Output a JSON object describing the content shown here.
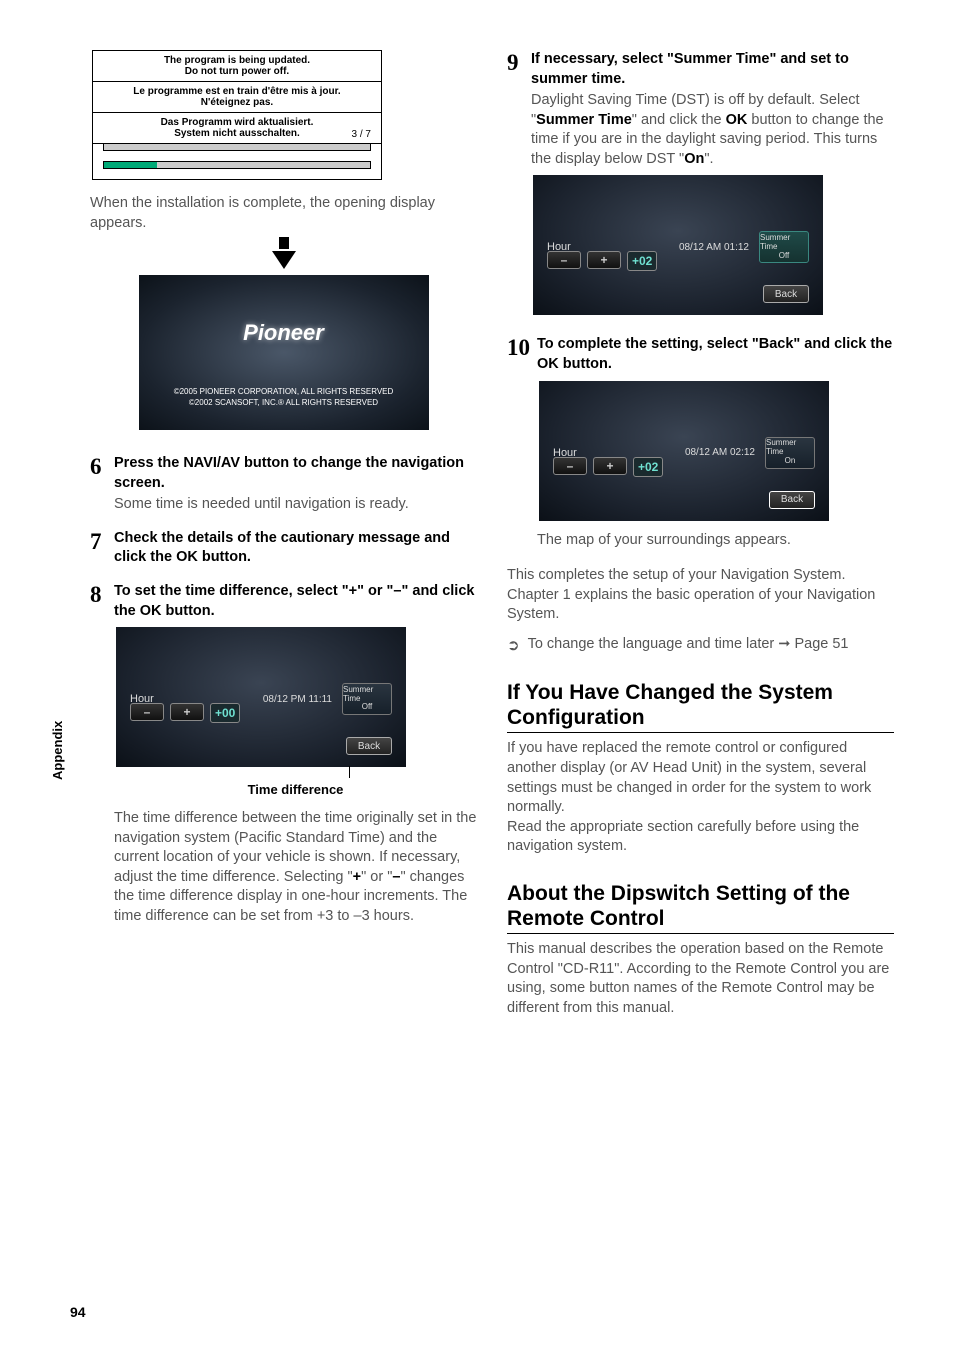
{
  "sideLabel": "Appendix",
  "pageNumber": "94",
  "col1": {
    "update": {
      "line1a": "The program is being updated.",
      "line1b": "Do not turn power off.",
      "line2a": "Le programme est en train d'être mis à jour.",
      "line2b": "N'éteignez pas.",
      "line3a": "Das Programm wird aktualisiert.",
      "line3b": "System nicht ausschalten.",
      "counter": "3 / 7"
    },
    "afterUpdate": "When the installation is complete, the opening display appears.",
    "pioneer": {
      "logo": "Pioneer",
      "rights1": "©2005 PIONEER CORPORATION, ALL RIGHTS RESERVED",
      "rights2": "©2002 SCANSOFT, INC.® ALL RIGHTS RESERVED"
    },
    "step6": {
      "num": "6",
      "headA": "Press the ",
      "headB": "NAVI/AV",
      "headC": " button to change the navigation screen.",
      "body": "Some time is needed until navigation is ready."
    },
    "step7": {
      "num": "7",
      "headA": "Check the details of the cautionary message and click the ",
      "headB": "OK",
      "headC": " button."
    },
    "step8": {
      "num": "8",
      "headA": "To set the time difference, select \"+\" or \"–\" and click the ",
      "headB": "OK",
      "headC": " button.",
      "caption": "Time difference",
      "body": "The time difference between the time originally set in the navigation system (Pacific Standard Time) and the current location of your vehicle is shown. If necessary, adjust the time difference. Selecting \"",
      "bodyPlus": "+",
      "bodyMid": "\" or \"",
      "bodyMinus": "–",
      "bodyEnd": "\" changes the time difference display in one-hour increments. The time difference can be set from +3 to –3 hours."
    },
    "time8": {
      "hourLabel": "Hour",
      "date": "08/12  PM  11:11",
      "value": "+00",
      "summer": "Summer Time",
      "summerState": "Off",
      "back": "Back",
      "minus": "–",
      "plus": "+"
    }
  },
  "col2": {
    "step9": {
      "num": "9",
      "head": "If necessary, select \"Summer Time\" and set to summer time.",
      "bodyA": "Daylight Saving Time (DST) is off by default. Select \"",
      "bodyB": "Summer Time",
      "bodyC": "\" and click the ",
      "bodyD": "OK",
      "bodyE": " button to change the time if you are in the daylight saving period. This turns the display below DST \"",
      "bodyF": "On",
      "bodyG": "\"."
    },
    "time9": {
      "hourLabel": "Hour",
      "date": "08/12  AM  01:12",
      "value": "+02",
      "summer": "Summer Time",
      "summerState": "Off",
      "back": "Back",
      "minus": "–",
      "plus": "+"
    },
    "step10": {
      "num": "10",
      "headA": "To complete the setting, select \"Back\" and click the ",
      "headB": "OK",
      "headC": " button.",
      "after": "The map of your surroundings appears."
    },
    "time10": {
      "hourLabel": "Hour",
      "date": "08/12  AM  02:12",
      "value": "+02",
      "summer": "Summer Time",
      "summerState": "On",
      "back": "Back",
      "minus": "–",
      "plus": "+"
    },
    "completion": "This completes the setup of your Navigation System. Chapter 1 explains the basic operation of your Navigation System.",
    "xref": "To change the language and time later ➞ Page 51",
    "sec1": {
      "title": "If You Have Changed the System Configuration",
      "p1": "If you have replaced the remote control or configured another display (or AV Head Unit) in the system, several settings must be changed in order for the system to work normally.",
      "p2": "Read the appropriate section carefully before using the navigation system."
    },
    "sec2": {
      "title": "About the Dipswitch Setting of the Remote Control",
      "p1": "This manual describes the operation based on the Remote Control \"CD-R11\". According to the Remote Control you are using, some button names of the Remote Control may be different from this manual."
    }
  }
}
